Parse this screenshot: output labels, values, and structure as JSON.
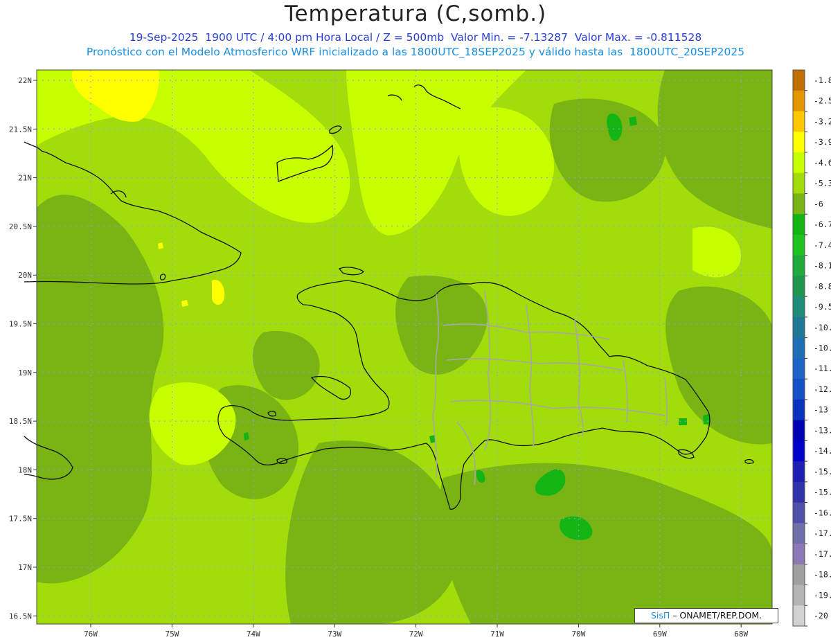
{
  "header": {
    "title": "Temperatura (C,somb.)",
    "line1": "19-Sep-2025  1900 UTC / 4:00 pm Hora Local / Z = 500mb  Valor Min. = -7.13287  Valor Max. = -0.811528",
    "line2": "Pronóstico con el Modelo Atmosferico WRF inicializado a las 1800UTC_18SEP2025 y válido hasta las  1800UTC_20SEP2025"
  },
  "axes": {
    "lat_labels": [
      "22N",
      "21.5N",
      "21N",
      "20.5N",
      "20N",
      "19.5N",
      "19N",
      "18.5N",
      "18N",
      "17.5N",
      "17N",
      "16.5N"
    ],
    "lon_labels": [
      "76W",
      "75W",
      "74W",
      "73W",
      "72W",
      "71W",
      "70W",
      "69W",
      "68W"
    ]
  },
  "colorbar": {
    "levels": [
      "-1.8",
      "-2.5",
      "-3.2",
      "-3.9",
      "-4.6",
      "-5.3",
      "-6",
      "-6.7",
      "-7.4",
      "-8.1",
      "-8.8",
      "-9.5",
      "-10.2",
      "-10.9",
      "-11.6",
      "-12.3",
      "-13",
      "-13.7",
      "-14.4",
      "-15.1",
      "-15.8",
      "-16.5",
      "-17.2",
      "-17.9",
      "-18.6",
      "-19.3",
      "-20"
    ],
    "colors": [
      "#c07000",
      "#e49600",
      "#ffc800",
      "#ffff00",
      "#c8ff00",
      "#a2dc0a",
      "#78b414",
      "#14b414",
      "#1ec31e",
      "#1eaa3c",
      "#1e9650",
      "#1e8c78",
      "#1e7896",
      "#1e6eb4",
      "#1e64c8",
      "#1450c8",
      "#0a32be",
      "#0000b4",
      "#0000c8",
      "#1e1eb4",
      "#3232aa",
      "#5050aa",
      "#7070aa",
      "#8c78b4",
      "#a0a0a0",
      "#b4b4b4",
      "#d2d2d2"
    ]
  },
  "credit": {
    "brand": "SisΠ",
    "text": " – ONAMET/REP.DOM."
  },
  "field": {
    "base": "#a2dc0a",
    "dark": "#78b414",
    "light": "#c8ff00",
    "yellow": "#ffff00",
    "green": "#14b414"
  }
}
